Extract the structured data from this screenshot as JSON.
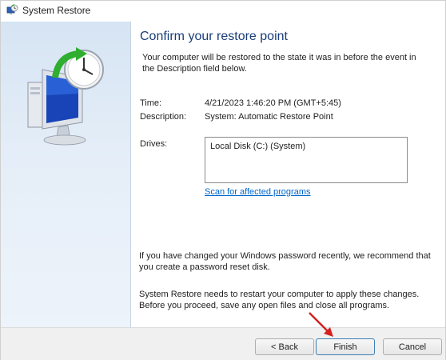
{
  "window": {
    "title": "System Restore"
  },
  "page": {
    "heading": "Confirm your restore point",
    "intro": "Your computer will be restored to the state it was in before the event in the Description field below.",
    "time_label": "Time:",
    "time_value": "4/21/2023 1:46:20 PM (GMT+5:45)",
    "description_label": "Description:",
    "description_value": "System: Automatic Restore Point",
    "drives_label": "Drives:",
    "drives": [
      "Local Disk (C:) (System)"
    ],
    "scan_link": "Scan for affected programs",
    "password_note": "If you have changed your Windows password recently, we recommend that you create a password reset disk.",
    "restart_note": "System Restore needs to restart your computer to apply these changes. Before you proceed, save any open files and close all programs."
  },
  "buttons": {
    "back": "< Back",
    "finish": "Finish",
    "cancel": "Cancel"
  },
  "colors": {
    "heading": "#1a3d78",
    "link": "#0066cc",
    "annotation_arrow": "#d42020"
  },
  "icons": {
    "title": "system-restore-icon",
    "sidebar": "computer-restore-clock-icon",
    "annotation": "red-pointer-arrow-icon"
  }
}
